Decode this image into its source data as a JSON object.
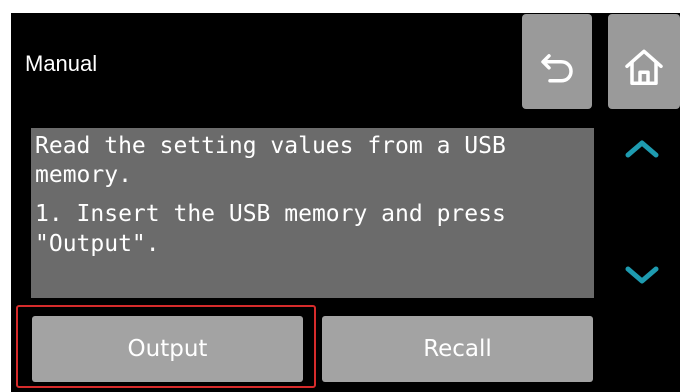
{
  "header": {
    "title": "Manual"
  },
  "toolbar": {
    "back_icon": "undo-arrow-icon",
    "home_icon": "home-icon"
  },
  "message": {
    "lines": [
      "Read the setting values from a USB",
      "memory.",
      "1. Insert the USB memory and press",
      "\"Output\"."
    ]
  },
  "scroll": {
    "up_icon": "chevron-up-icon",
    "down_icon": "chevron-down-icon"
  },
  "actions": {
    "output_label": "Output",
    "recall_label": "Recall"
  },
  "colors": {
    "screen_bg": "#000000",
    "button_bg": "#a3a3a3",
    "icon_button_bg": "#9a9a9a",
    "message_bg": "#6b6b6b",
    "accent": "#1e9bb0",
    "highlight": "#d62b2b"
  }
}
